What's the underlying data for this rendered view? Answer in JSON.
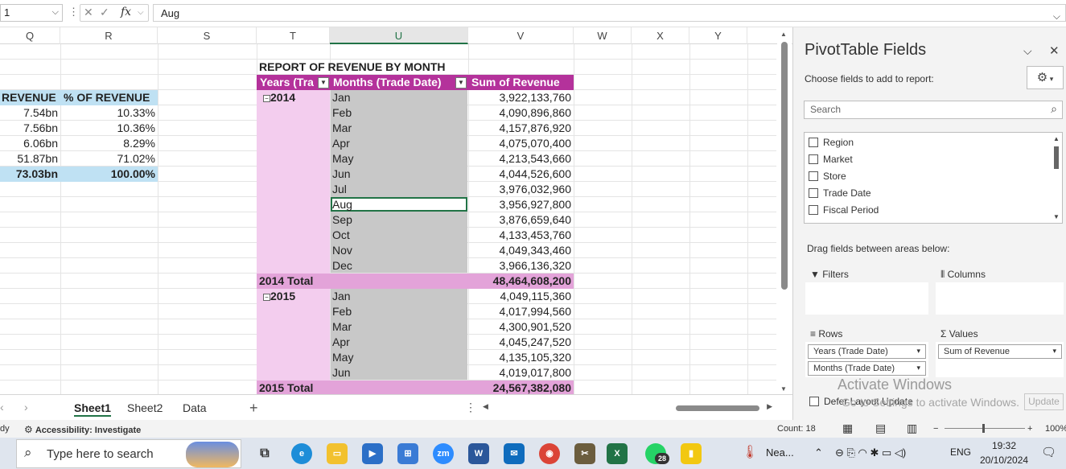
{
  "formula_bar": {
    "name_box": "1",
    "formula": "Aug",
    "fx": "fx"
  },
  "columns": [
    "Q",
    "R",
    "S",
    "T",
    "U",
    "V",
    "W",
    "X",
    "Y"
  ],
  "summary": {
    "header_revenue": "REVENUE",
    "header_pct": "% OF REVENUE",
    "rows": [
      {
        "revenue": "7.54bn",
        "pct": "10.33%"
      },
      {
        "revenue": "7.56bn",
        "pct": "10.36%"
      },
      {
        "revenue": "6.06bn",
        "pct": "8.29%"
      },
      {
        "revenue": "51.87bn",
        "pct": "71.02%"
      }
    ],
    "total_revenue": "73.03bn",
    "total_pct": "100.00%"
  },
  "pivot_report": {
    "title": "REPORT OF REVENUE BY MONTH",
    "col_years": "Years (Tra",
    "col_months": "Months (Trade Date)",
    "col_sum": "Sum of Revenue",
    "groups": [
      {
        "year": "2014",
        "months": [
          {
            "m": "Jan",
            "v": "3,922,133,760"
          },
          {
            "m": "Feb",
            "v": "4,090,896,860"
          },
          {
            "m": "Mar",
            "v": "4,157,876,920"
          },
          {
            "m": "Apr",
            "v": "4,075,070,400"
          },
          {
            "m": "May",
            "v": "4,213,543,660"
          },
          {
            "m": "Jun",
            "v": "4,044,526,600"
          },
          {
            "m": "Jul",
            "v": "3,976,032,960"
          },
          {
            "m": "Aug",
            "v": "3,956,927,800"
          },
          {
            "m": "Sep",
            "v": "3,876,659,640"
          },
          {
            "m": "Oct",
            "v": "4,133,453,760"
          },
          {
            "m": "Nov",
            "v": "4,049,343,460"
          },
          {
            "m": "Dec",
            "v": "3,966,136,320"
          }
        ],
        "total_label": "2014 Total",
        "total_value": "48,464,608,200"
      },
      {
        "year": "2015",
        "months": [
          {
            "m": "Jan",
            "v": "4,049,115,360"
          },
          {
            "m": "Feb",
            "v": "4,017,994,560"
          },
          {
            "m": "Mar",
            "v": "4,300,901,520"
          },
          {
            "m": "Apr",
            "v": "4,045,247,520"
          },
          {
            "m": "May",
            "v": "4,135,105,320"
          },
          {
            "m": "Jun",
            "v": "4,019,017,800"
          }
        ],
        "total_label": "2015 Total",
        "total_value": "24,567,382,080"
      }
    ]
  },
  "sheet_tabs": {
    "tabs": [
      "Sheet1",
      "Sheet2",
      "Data"
    ],
    "active": "Sheet1",
    "add": "+"
  },
  "status_bar": {
    "ready": "dy",
    "accessibility": "Accessibility: Investigate",
    "count": "Count: 18",
    "zoom": "100%"
  },
  "pivot_panel": {
    "title": "PivotTable Fields",
    "subtitle": "Choose fields to add to report:",
    "search_placeholder": "Search",
    "fields": [
      "Region",
      "Market",
      "Store",
      "Trade Date",
      "Fiscal Period"
    ],
    "drag_hint": "Drag fields between areas below:",
    "filters": "Filters",
    "columns": "Columns",
    "rows": "Rows",
    "values": "Values",
    "rows_items": [
      "Years (Trade Date)",
      "Months (Trade Date)"
    ],
    "values_items": [
      "Sum of Revenue"
    ],
    "defer": "Defer Layout Update",
    "update": "Update",
    "watermark_title": "Activate Windows",
    "watermark_sub": "Go to Settings to activate Windows."
  },
  "taskbar": {
    "search_placeholder": "Type here to search",
    "weather": "Nea...",
    "lang": "ENG",
    "time": "19:32",
    "date": "20/10/2024",
    "whatsapp_badge": "28"
  },
  "colors": {
    "pivot_header": "#b4329b",
    "pivot_light": "#f3cdee",
    "pivot_total": "#e3a3d9",
    "summary_header": "#bfe1f3",
    "selected_cells": "#c8c8c8",
    "excel_green": "#217346"
  }
}
